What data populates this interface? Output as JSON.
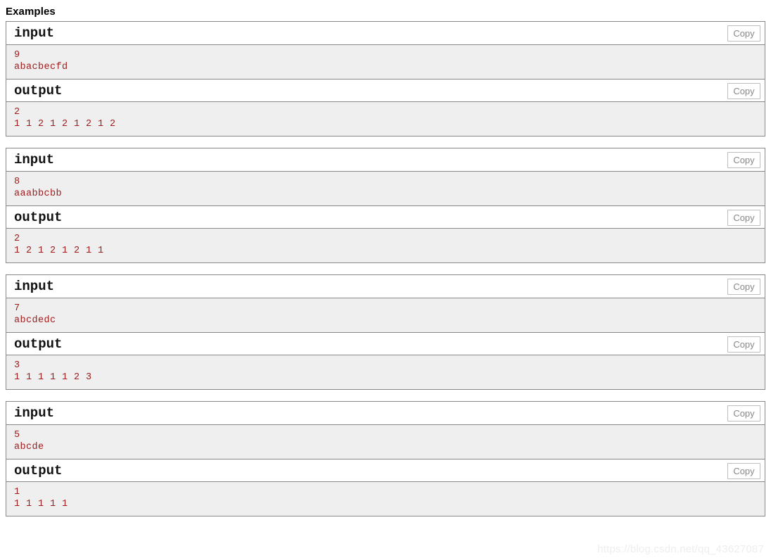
{
  "section": {
    "title": "Examples"
  },
  "labels": {
    "input": "input",
    "output": "output",
    "copy": "Copy"
  },
  "colors": {
    "code_text": "#9c1c1c",
    "body_background": "#efeff0",
    "border": "#888888",
    "copy_text": "#888888",
    "copy_border": "#bdbdbd",
    "watermark": "#eeeeee"
  },
  "examples": [
    {
      "input_lines": [
        "9",
        "abacbecfd"
      ],
      "output_lines": [
        "2",
        "1 1 2 1 2 1 2 1 2"
      ]
    },
    {
      "input_lines": [
        "8",
        "aaabbcbb"
      ],
      "output_lines": [
        "2",
        "1 2 1 2 1 2 1 1"
      ]
    },
    {
      "input_lines": [
        "7",
        "abcdedc"
      ],
      "output_lines": [
        "3",
        "1 1 1 1 1 2 3"
      ]
    },
    {
      "input_lines": [
        "5",
        "abcde"
      ],
      "output_lines": [
        "1",
        "1 1 1 1 1"
      ]
    }
  ],
  "watermark": "https://blog.csdn.net/qq_43627087"
}
